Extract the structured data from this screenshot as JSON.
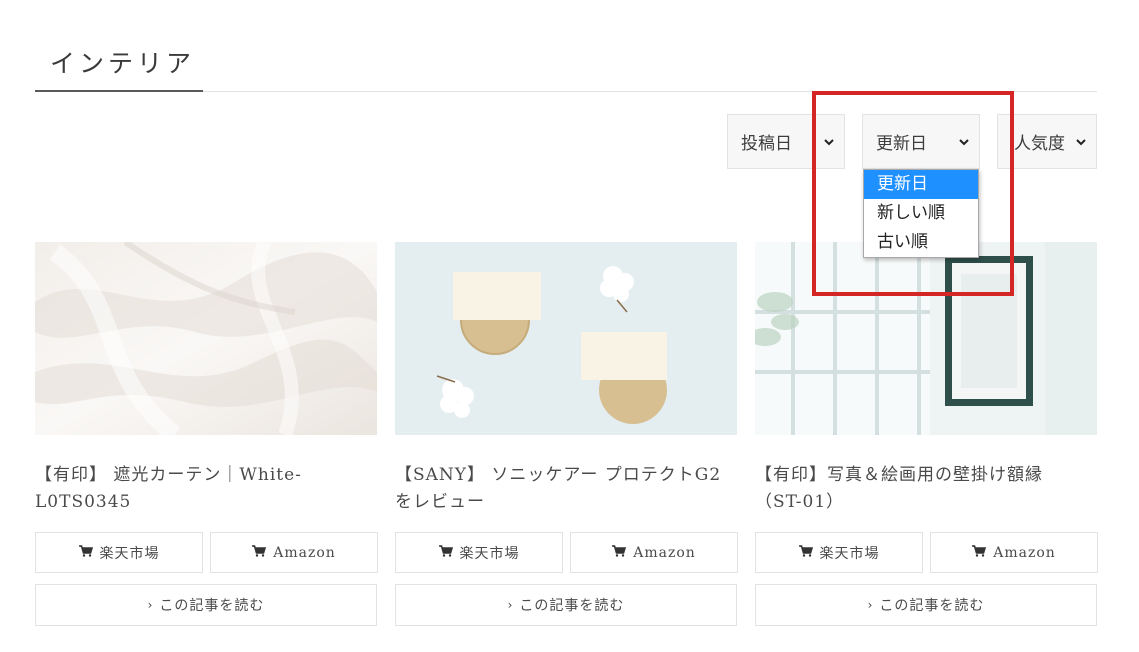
{
  "page": {
    "title": "インテリア"
  },
  "sort": {
    "posted_label": "投稿日",
    "updated_label": "更新日",
    "popularity_label": "人気度",
    "dropdown_options": [
      "更新日",
      "新しい順",
      "古い順"
    ],
    "selected_index": 0
  },
  "cards": [
    {
      "title_line1": "【有印】 遮光カーテン｜White-",
      "title_line2": "L0TS0345",
      "rakuten_label": "楽天市場",
      "amazon_label": "Amazon",
      "read_label": "この記事を読む"
    },
    {
      "title_line1": "【SANY】 ソニッケアー プロテクトG2",
      "title_line2": "をレビュー",
      "rakuten_label": "楽天市場",
      "amazon_label": "Amazon",
      "read_label": "この記事を読む"
    },
    {
      "title_line1": "【有印】写真＆絵画用の壁掛け額縁",
      "title_line2": "（ST-01）",
      "rakuten_label": "楽天市場",
      "amazon_label": "Amazon",
      "read_label": "この記事を読む"
    }
  ],
  "icons": {
    "cart": "cart-icon",
    "chevron_right": "chevron-right-icon",
    "chevron_down": "chevron-down-icon"
  },
  "colors": {
    "highlight": "#d52626",
    "selected_option": "#1e90ff",
    "border": "#e3e3e3"
  }
}
